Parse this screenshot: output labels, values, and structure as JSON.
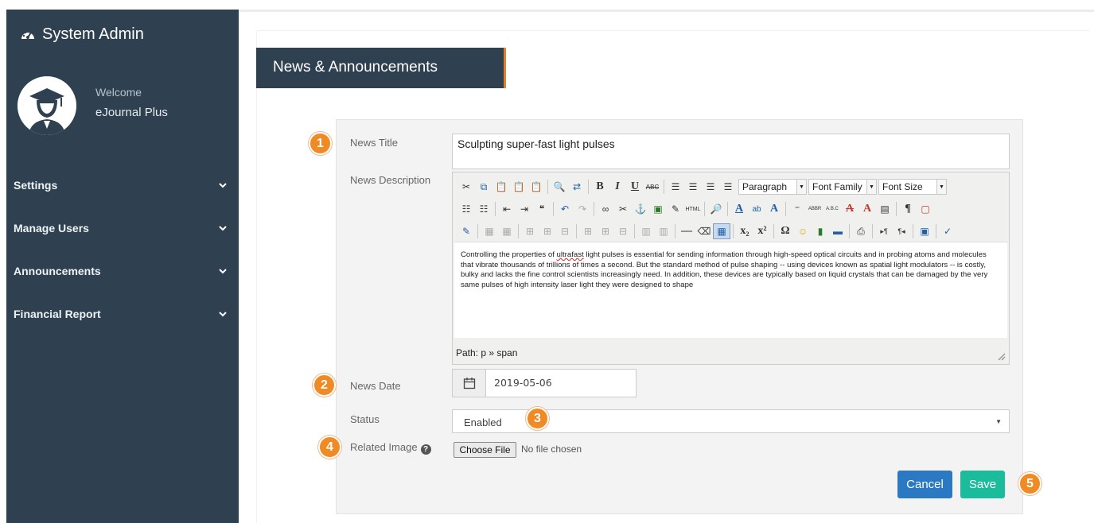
{
  "sidebar": {
    "brand": "System Admin",
    "welcome": "Welcome",
    "username": "eJournal Plus",
    "items": [
      {
        "label": "Settings"
      },
      {
        "label": "Manage Users"
      },
      {
        "label": "Announcements"
      },
      {
        "label": "Financial Report"
      }
    ]
  },
  "page": {
    "title": "News & Announcements"
  },
  "form": {
    "news_title_label": "News Title",
    "news_title_value": "Sculpting super-fast light pulses",
    "news_description_label": "News Description",
    "editor": {
      "format_select": "Paragraph",
      "font_family_select": "Font Family",
      "font_size_select": "Font Size",
      "body_text_1": "Controlling the properties of ",
      "body_text_misspelled": "ultrafast",
      "body_text_2": " light pulses is essential for sending information through high-speed optical circuits and in probing atoms and molecules that vibrate thousands of trillions of times a second. But the standard method of pulse shaping -- using devices known as spatial light modulators -- is costly, bulky and lacks the fine control scientists increasingly need. In addition, these devices are typically based on liquid crystals that can be damaged by the very same pulses of high intensity laser light they were designed to shape",
      "path": "Path: p » span"
    },
    "news_date_label": "News Date",
    "news_date_value": "2019-05-06",
    "status_label": "Status",
    "status_value": "Enabled",
    "related_image_label": "Related Image",
    "choose_file_label": "Choose File",
    "no_file_text": "No file chosen",
    "cancel_label": "Cancel",
    "save_label": "Save"
  },
  "callouts": [
    "1",
    "2",
    "3",
    "4",
    "5"
  ],
  "colors": {
    "sidebar": "#2f4050",
    "accent": "#e97d25",
    "badge": "#f08a24",
    "cancel": "#2b79c2",
    "save": "#1abc9c"
  }
}
